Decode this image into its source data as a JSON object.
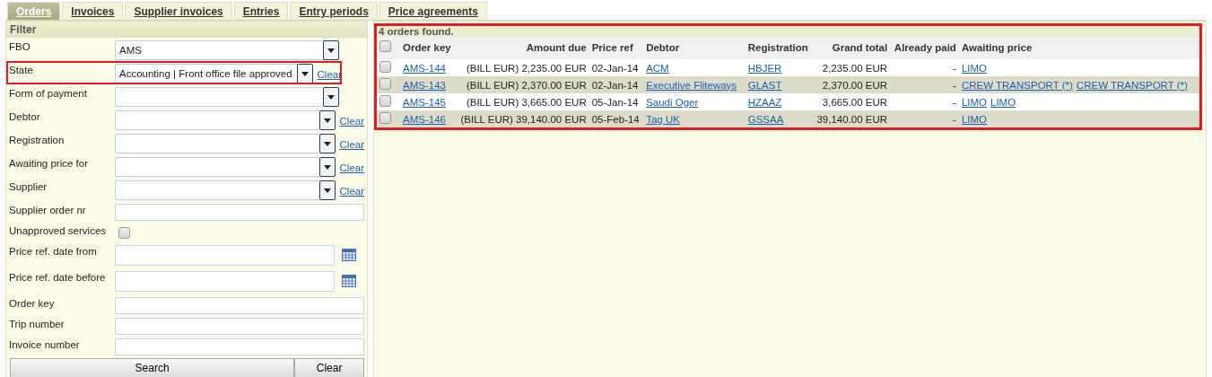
{
  "tabs": [
    {
      "label": "Orders",
      "selected": true
    },
    {
      "label": "Invoices",
      "selected": false
    },
    {
      "label": "Supplier invoices",
      "selected": false
    },
    {
      "label": "Entries",
      "selected": false
    },
    {
      "label": "Entry periods",
      "selected": false
    },
    {
      "label": "Price agreements",
      "selected": false
    }
  ],
  "filter": {
    "title": "Filter",
    "fields": [
      {
        "label": "FBO",
        "kind": "select",
        "value": "AMS",
        "highlighted": false
      },
      {
        "label": "State",
        "kind": "select",
        "value": "Accounting | Front office file approved",
        "clear": "Clear",
        "highlighted": true
      },
      {
        "label": "Form of payment",
        "kind": "select",
        "highlighted": false
      },
      {
        "label": "Debtor",
        "kind": "select",
        "clear": "Clear",
        "highlighted": false
      },
      {
        "label": "Registration",
        "kind": "select",
        "clear": "Clear",
        "highlighted": false
      },
      {
        "label": "Awaiting price for",
        "kind": "select",
        "clear": "Clear",
        "highlighted": false
      },
      {
        "label": "Supplier",
        "kind": "select",
        "clear": "Clear",
        "highlighted": false
      },
      {
        "label": "Supplier order nr",
        "kind": "text",
        "highlighted": false
      },
      {
        "label": "Unapproved services",
        "kind": "checkbox",
        "checked": false,
        "highlighted": false
      },
      {
        "label": "Price ref. date from",
        "kind": "date",
        "highlighted": false
      },
      {
        "label": "Price ref. date before",
        "kind": "date",
        "highlighted": false
      },
      {
        "label": "Order key",
        "kind": "text",
        "highlighted": false
      },
      {
        "label": "Trip number",
        "kind": "text",
        "highlighted": false
      },
      {
        "label": "Invoice number",
        "kind": "text",
        "highlighted": false
      }
    ],
    "buttons": [
      "Search",
      "Clear"
    ]
  },
  "results": {
    "summary": "4 orders found.",
    "highlighted": true,
    "select_all_checked": false,
    "columns": [
      "Order key",
      "Amount due",
      "Price ref",
      "Debtor",
      "Registration",
      "Grand total",
      "Already paid",
      "Awaiting price"
    ],
    "rows": [
      {
        "checked": false,
        "order_key": "AMS-144",
        "amount_due": "(BILL EUR) 2,235.00 EUR",
        "price_ref": "02-Jan-14",
        "debtor": "ACM",
        "registration": "HBJER",
        "grand_total": "2,235.00 EUR",
        "already_paid": "-",
        "awaiting_price": [
          "LIMO"
        ]
      },
      {
        "checked": false,
        "order_key": "AMS-143",
        "amount_due": "(BILL EUR) 2,370.00 EUR",
        "price_ref": "02-Jan-14",
        "debtor": "Executive Fliteways",
        "registration": "GLAST",
        "grand_total": "2,370.00 EUR",
        "already_paid": "-",
        "awaiting_price": [
          "CREW TRANSPORT (*)",
          "CREW TRANSPORT (*)"
        ]
      },
      {
        "checked": false,
        "order_key": "AMS-145",
        "amount_due": "(BILL EUR) 3,665.00 EUR",
        "price_ref": "05-Jan-14",
        "debtor": "Saudi Oger",
        "registration": "HZAAZ",
        "grand_total": "3,665.00 EUR",
        "already_paid": "-",
        "awaiting_price": [
          "LIMO",
          "LIMO"
        ]
      },
      {
        "checked": false,
        "order_key": "AMS-146",
        "amount_due": "(BILL EUR) 39,140.00 EUR",
        "price_ref": "05-Feb-14",
        "debtor": "Tag UK",
        "registration": "GSSAA",
        "grand_total": "39,140.00 EUR",
        "already_paid": "-",
        "awaiting_price": [
          "LIMO"
        ]
      }
    ]
  }
}
